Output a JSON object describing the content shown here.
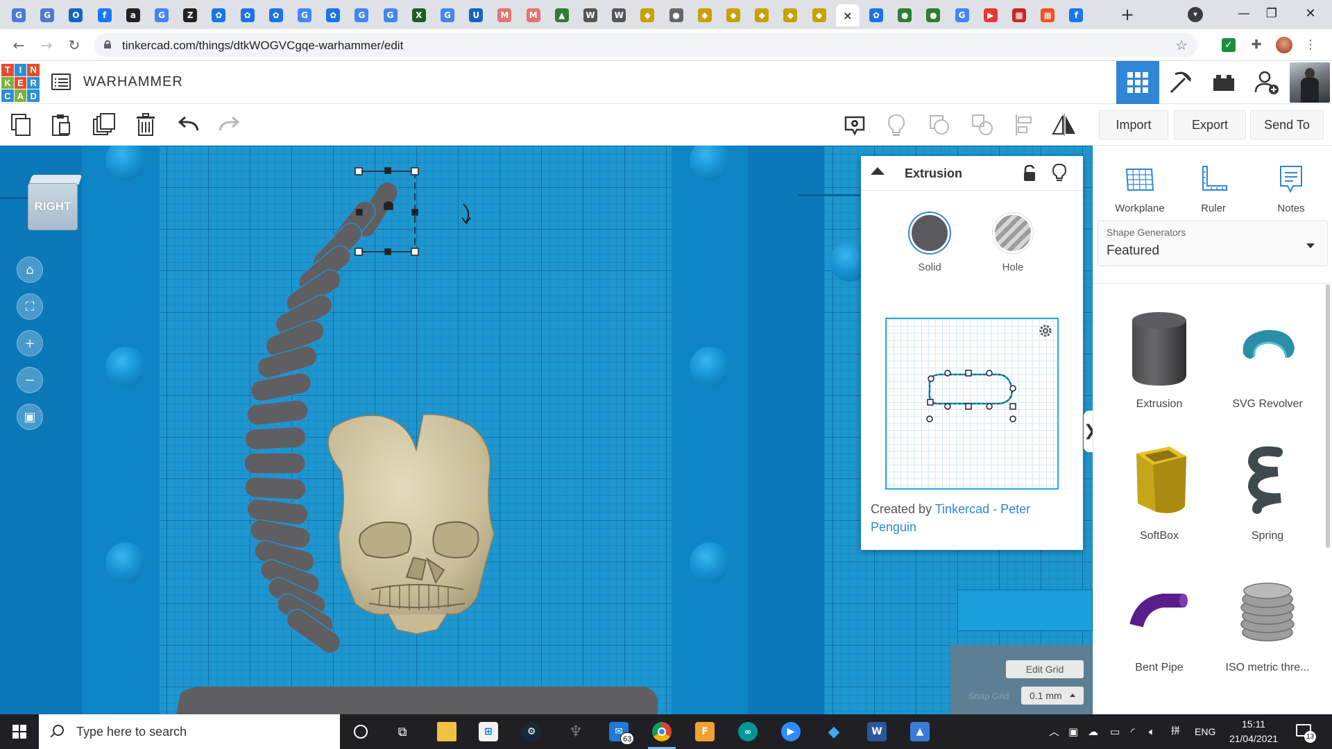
{
  "browser": {
    "tabs": [
      {
        "icon": "google-contacts-icon",
        "glyph": "G",
        "color": "#4a7bd1"
      },
      {
        "icon": "google-contacts-icon",
        "glyph": "G",
        "color": "#4a7bd1"
      },
      {
        "icon": "outlook-icon",
        "glyph": "O",
        "color": "#1565c0"
      },
      {
        "icon": "facebook-icon",
        "glyph": "f",
        "color": "#1877f2"
      },
      {
        "icon": "amazon-icon",
        "glyph": "a",
        "color": "#222222"
      },
      {
        "icon": "google-icon",
        "glyph": "G",
        "color": "#4285f4"
      },
      {
        "icon": "z-icon",
        "glyph": "Z",
        "color": "#222222"
      },
      {
        "icon": "gear-blue-icon",
        "glyph": "✿",
        "color": "#1a73e8"
      },
      {
        "icon": "gear-blue-icon",
        "glyph": "✿",
        "color": "#1a73e8"
      },
      {
        "icon": "gear-blue-icon",
        "glyph": "✿",
        "color": "#1a73e8"
      },
      {
        "icon": "google-icon",
        "glyph": "G",
        "color": "#4285f4"
      },
      {
        "icon": "gear-blue-icon",
        "glyph": "✿",
        "color": "#1a73e8"
      },
      {
        "icon": "google-icon",
        "glyph": "G",
        "color": "#4285f4"
      },
      {
        "icon": "google-icon",
        "glyph": "G",
        "color": "#4285f4"
      },
      {
        "icon": "x-app-icon",
        "glyph": "X",
        "color": "#1b5e20"
      },
      {
        "icon": "google-icon",
        "glyph": "G",
        "color": "#4285f4"
      },
      {
        "icon": "u-icon",
        "glyph": "U",
        "color": "#1565c0"
      },
      {
        "icon": "mg-icon",
        "glyph": "M",
        "color": "#e57373"
      },
      {
        "icon": "mg-icon",
        "glyph": "M",
        "color": "#e57373"
      },
      {
        "icon": "drive-icon",
        "glyph": "▲",
        "color": "#2e7d32"
      },
      {
        "icon": "wikipedia-icon",
        "glyph": "W",
        "color": "#555555"
      },
      {
        "icon": "wikipedia-icon",
        "glyph": "W",
        "color": "#555555"
      },
      {
        "icon": "warhammer-icon",
        "glyph": "◆",
        "color": "#c8a000"
      },
      {
        "icon": "globe-icon",
        "glyph": "●",
        "color": "#666666"
      },
      {
        "icon": "warhammer-icon",
        "glyph": "◆",
        "color": "#c8a000"
      },
      {
        "icon": "warhammer-icon",
        "glyph": "◆",
        "color": "#c8a000"
      },
      {
        "icon": "warhammer-icon",
        "glyph": "◆",
        "color": "#c8a000"
      },
      {
        "icon": "warhammer-icon",
        "glyph": "◆",
        "color": "#c8a000"
      },
      {
        "icon": "warhammer-icon",
        "glyph": "◆",
        "color": "#c8a000"
      },
      {
        "icon": "close-tab-icon",
        "glyph": "×",
        "color": "#ffffff",
        "active": true
      },
      {
        "icon": "gear-blue-icon",
        "glyph": "✿",
        "color": "#1a73e8"
      },
      {
        "icon": "green-circle-icon",
        "glyph": "●",
        "color": "#2e7d32"
      },
      {
        "icon": "green-circle-icon",
        "glyph": "●",
        "color": "#2e7d32"
      },
      {
        "icon": "google-icon",
        "glyph": "G",
        "color": "#4285f4"
      },
      {
        "icon": "youtube-icon",
        "glyph": "▶",
        "color": "#e53935"
      },
      {
        "icon": "grid-app-icon",
        "glyph": "▦",
        "color": "#c62828"
      },
      {
        "icon": "microsoft-icon",
        "glyph": "▦",
        "color": "#f25022"
      },
      {
        "icon": "facebook-icon",
        "glyph": "f",
        "color": "#1877f2"
      }
    ],
    "url": "tinkercad.com/things/dtkWOGVCgqe-warhammer/edit"
  },
  "header": {
    "project_title": "WARHAMMER",
    "logo_letters": [
      "T",
      "I",
      "N",
      "K",
      "E",
      "R",
      "C",
      "A",
      "D"
    ],
    "logo_colors": [
      "#e54c2e",
      "#2c8fd6",
      "#e54c2e",
      "#7db241",
      "#e54c2e",
      "#2c8fd6",
      "#2c8fd6",
      "#7db241",
      "#2c8fd6"
    ]
  },
  "toolbar": {
    "import_label": "Import",
    "export_label": "Export",
    "sendto_label": "Send To"
  },
  "viewcube": {
    "face_label": "RIGHT"
  },
  "inspector": {
    "title": "Extrusion",
    "solid_label": "Solid",
    "hole_label": "Hole",
    "credit_prefix": "Created by ",
    "credit_author": "Tinkercad - Peter Penguin"
  },
  "right_panel": {
    "workplane_label": "Workplane",
    "ruler_label": "Ruler",
    "notes_label": "Notes",
    "shape_generators_caption": "Shape Generators",
    "shape_generators_value": "Featured",
    "shapes": [
      {
        "label": "Extrusion"
      },
      {
        "label": "SVG Revolver"
      },
      {
        "label": "SoftBox"
      },
      {
        "label": "Spring"
      },
      {
        "label": "Bent Pipe"
      },
      {
        "label": "ISO metric thre..."
      }
    ]
  },
  "grid_controls": {
    "edit_grid_label": "Edit Grid",
    "snap_grid_label": "Snap Grid",
    "snap_grid_value": "0.1 mm"
  },
  "taskbar": {
    "search_placeholder": "Type here to search",
    "mail_badge": "63",
    "language": "ENG",
    "time": "15:11",
    "date": "21/04/2021",
    "notification_count": "13"
  }
}
